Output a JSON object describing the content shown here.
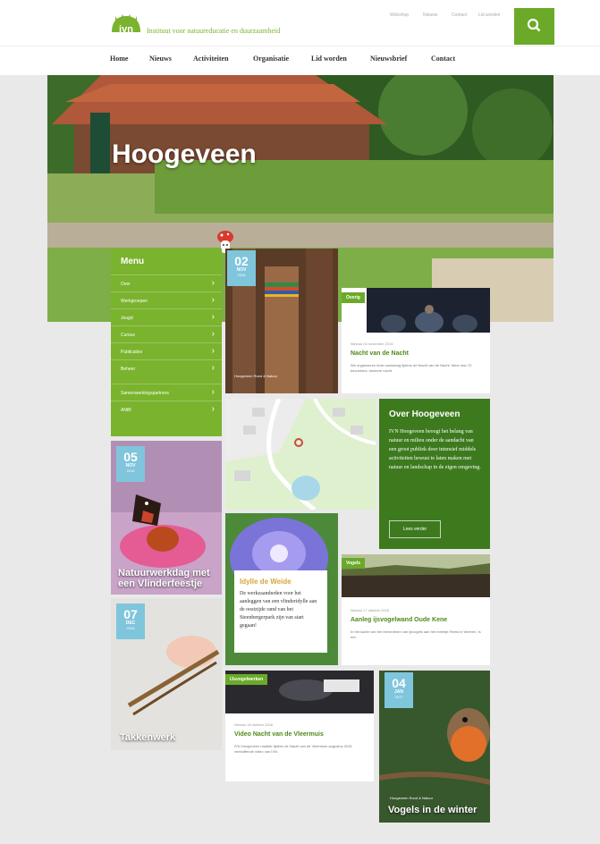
{
  "brand": {
    "tagline": "Instituut voor natuureducatie en duurzaamheid"
  },
  "utility_nav": [
    "Webshop",
    "Nieuws",
    "Contact",
    "Lid worden"
  ],
  "main_nav": [
    "Home",
    "Nieuws",
    "Activiteiten",
    "Organisatie",
    "Lid worden",
    "Nieuwsbrief",
    "Contact"
  ],
  "hero": {
    "title": "Hoogeveen"
  },
  "menu": {
    "title": "Menu",
    "items": [
      "Over",
      "Werkgroepen",
      "Jeugd",
      "Cursus",
      "Publicaties",
      "Beheer",
      "Samenwerkingspartners",
      "ANBI"
    ]
  },
  "tiles": {
    "t1": {
      "day": "02",
      "month": "NOV",
      "year": "2016",
      "meta": "Hoogeveen  Rond & Natuur"
    },
    "t2": {
      "tag": "Overig",
      "date": "Nieuws 03 november 2016",
      "title": "Nacht van de Nacht",
      "text": "We organiseren ieder aanwezig tijdens de Nacht van de Nacht. Meer dan 70 bezoekers, donkere nacht."
    },
    "t3": {
      "title": "Over Hoogeveen",
      "text": "IVN Hoogeveen beoogt het belang van natuur en milieu onder de aandacht van een groot publiek door intensief middels activiteiten bewust te laten maken met natuur en landschap in de eigen omgeving.",
      "button": "Lees verder"
    },
    "t4": {
      "day": "05",
      "month": "NOV",
      "year": "2016",
      "caption": "Natuurwerkdag met een Vlinderfeestje"
    },
    "t5": {
      "title": "Idylle de Weide",
      "text": "De werkzaamheden voor het aanleggen van een vlinderidylle aan de oostzijde rand van het Steenbergerpark zijn van start gegaan!"
    },
    "t6": {
      "tag": "Vogels",
      "date": "Nieuws 17 oktober 2016",
      "title": "Aanleg ijsvogelwand Oude Kene",
      "text": "In het kader van het bevorderen van ijsvogels aan het meertje Reest in Weeren, is het."
    },
    "t7": {
      "day": "07",
      "month": "DEC",
      "year": "2016",
      "caption": "Takkenwerk"
    },
    "t8": {
      "tag": "IJsvogelwerken",
      "date": "Nieuws 18 oktober 2016",
      "title": "Video Nacht van de Vleermuis",
      "text": "IVN Hoogeveen maakte tijdens de Nacht van de Vleermuis augustus 2016 verbluffende video van IVN."
    },
    "t9": {
      "day": "04",
      "month": "JAN",
      "year": "2017",
      "caption": "Vogels in de winter",
      "meta": "Hoogeveen  Rond & Natuur"
    }
  },
  "colors": {
    "brand": "#6aaa28",
    "menu": "#7ab32e",
    "date": "#7fc5dc",
    "about": "#3d7a1e",
    "title": "#4e8a1c"
  }
}
